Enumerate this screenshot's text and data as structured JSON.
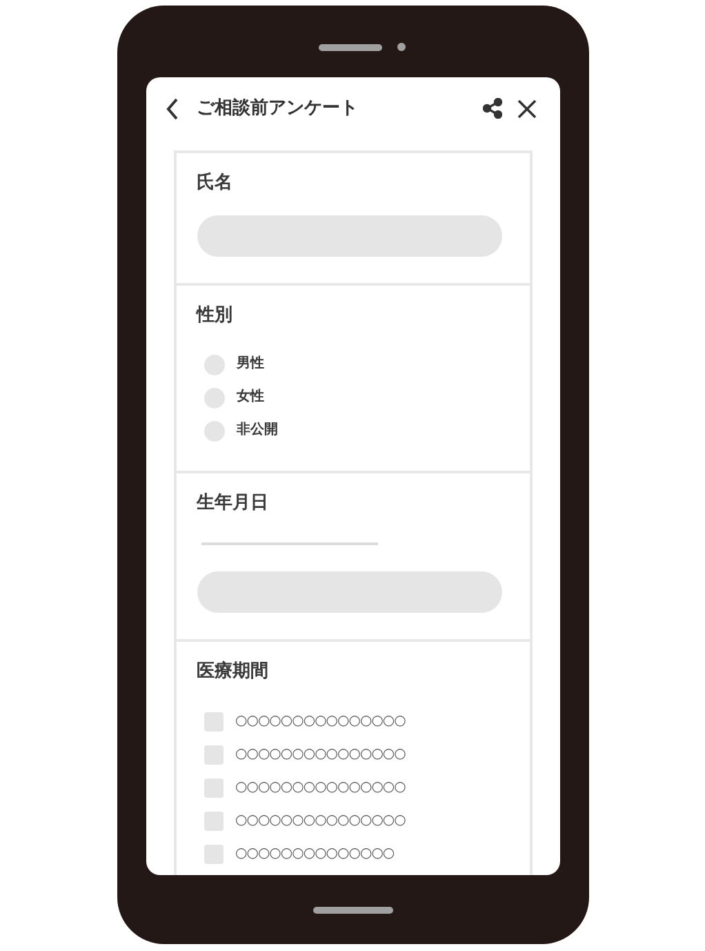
{
  "header": {
    "title": "ご相談前アンケート"
  },
  "sections": [
    {
      "kind": "text",
      "label": "氏名"
    },
    {
      "kind": "radio",
      "label": "性別",
      "options": [
        {
          "label": "男性",
          "selected": false
        },
        {
          "label": "女性",
          "selected": false
        },
        {
          "label": "非公開",
          "selected": false
        }
      ]
    },
    {
      "kind": "date",
      "label": "生年月日"
    },
    {
      "kind": "checkbox",
      "label": "医療期間",
      "options": [
        {
          "label": "○○○○○○○○○○○○○○○",
          "checked": false
        },
        {
          "label": "○○○○○○○○○○○○○○○",
          "checked": false
        },
        {
          "label": "○○○○○○○○○○○○○○○",
          "checked": false
        },
        {
          "label": "○○○○○○○○○○○○○○○",
          "checked": false
        },
        {
          "label": "○○○○○○○○○○○○○○",
          "checked": false
        }
      ]
    }
  ]
}
